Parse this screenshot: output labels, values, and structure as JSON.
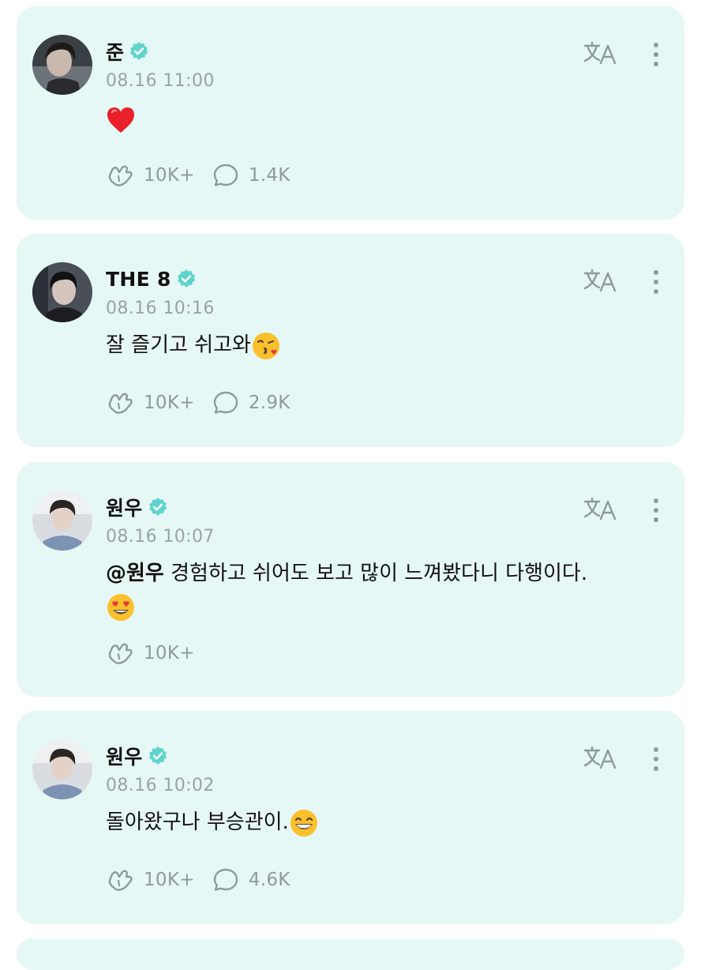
{
  "posts": [
    {
      "author": "준",
      "timestamp": "08.16 11:00",
      "mention": "",
      "text": "",
      "emoji": "heart",
      "likes": "10K+",
      "comments": "1.4K"
    },
    {
      "author": "THE 8",
      "timestamp": "08.16 10:16",
      "mention": "",
      "text": "잘 즐기고 쉬고와",
      "emoji": "kiss",
      "likes": "10K+",
      "comments": "2.9K"
    },
    {
      "author": "원우",
      "timestamp": "08.16 10:07",
      "mention": "@원우",
      "text": " 경험하고 쉬어도 보고 많이 느껴봤다니 다행이다.",
      "emoji": "heart-eyes",
      "likes": "10K+",
      "comments": ""
    },
    {
      "author": "원우",
      "timestamp": "08.16 10:02",
      "mention": "",
      "text": "돌아왔구나 부승관이.",
      "emoji": "grin",
      "likes": "10K+",
      "comments": "4.6K"
    }
  ],
  "colors": {
    "card_bg": "#e6f8f5",
    "verified": "#5fd4cc",
    "muted": "#8f9a9a"
  }
}
